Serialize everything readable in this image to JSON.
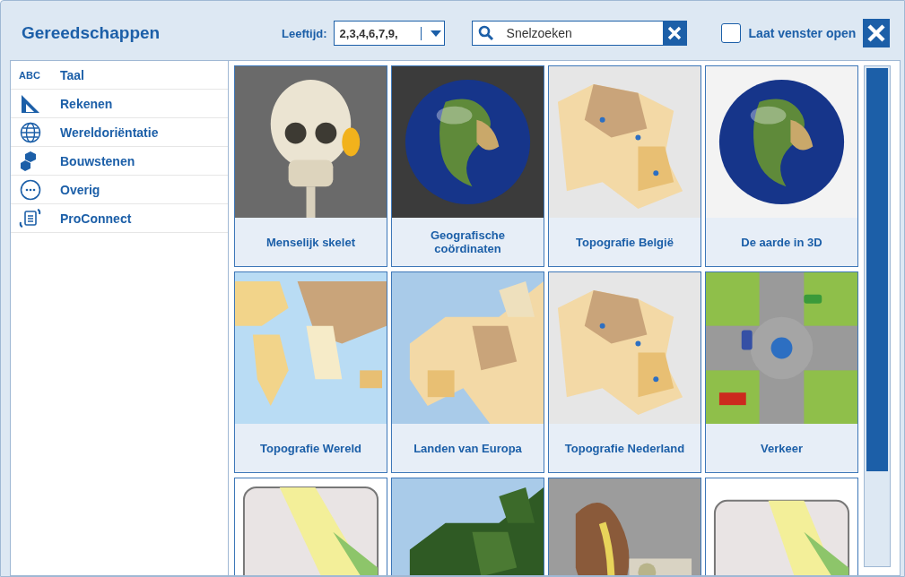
{
  "header": {
    "title": "Gereedschappen",
    "age_label": "Leeftijd:",
    "age_value": "2,3,4,6,7,9,",
    "search": {
      "placeholder": "Snelzoeken"
    },
    "keep_open": {
      "label": "Laat venster open",
      "checked": false
    }
  },
  "sidebar": {
    "items": [
      {
        "label": "Taal",
        "icon_text": "ABC"
      },
      {
        "label": "Rekenen"
      },
      {
        "label": "Wereldoriëntatie"
      },
      {
        "label": "Bouwstenen"
      },
      {
        "label": "Overig"
      },
      {
        "label": "ProConnect"
      }
    ]
  },
  "tiles": [
    {
      "label": "Menselijk skelet",
      "kind": "picture"
    },
    {
      "label": "Geografische coördinaten",
      "kind": "picture"
    },
    {
      "label": "Topografie België",
      "kind": "picture"
    },
    {
      "label": "De aarde in 3D",
      "kind": "picture"
    },
    {
      "label": "Topografie Wereld",
      "kind": "picture"
    },
    {
      "label": "Landen van Europa",
      "kind": "picture"
    },
    {
      "label": "Topografie Nederland",
      "kind": "picture"
    },
    {
      "label": "Verkeer",
      "kind": "picture"
    },
    {
      "kind": "picture"
    },
    {
      "kind": "picture"
    },
    {
      "kind": "picture"
    },
    {
      "kind": "picture"
    }
  ]
}
